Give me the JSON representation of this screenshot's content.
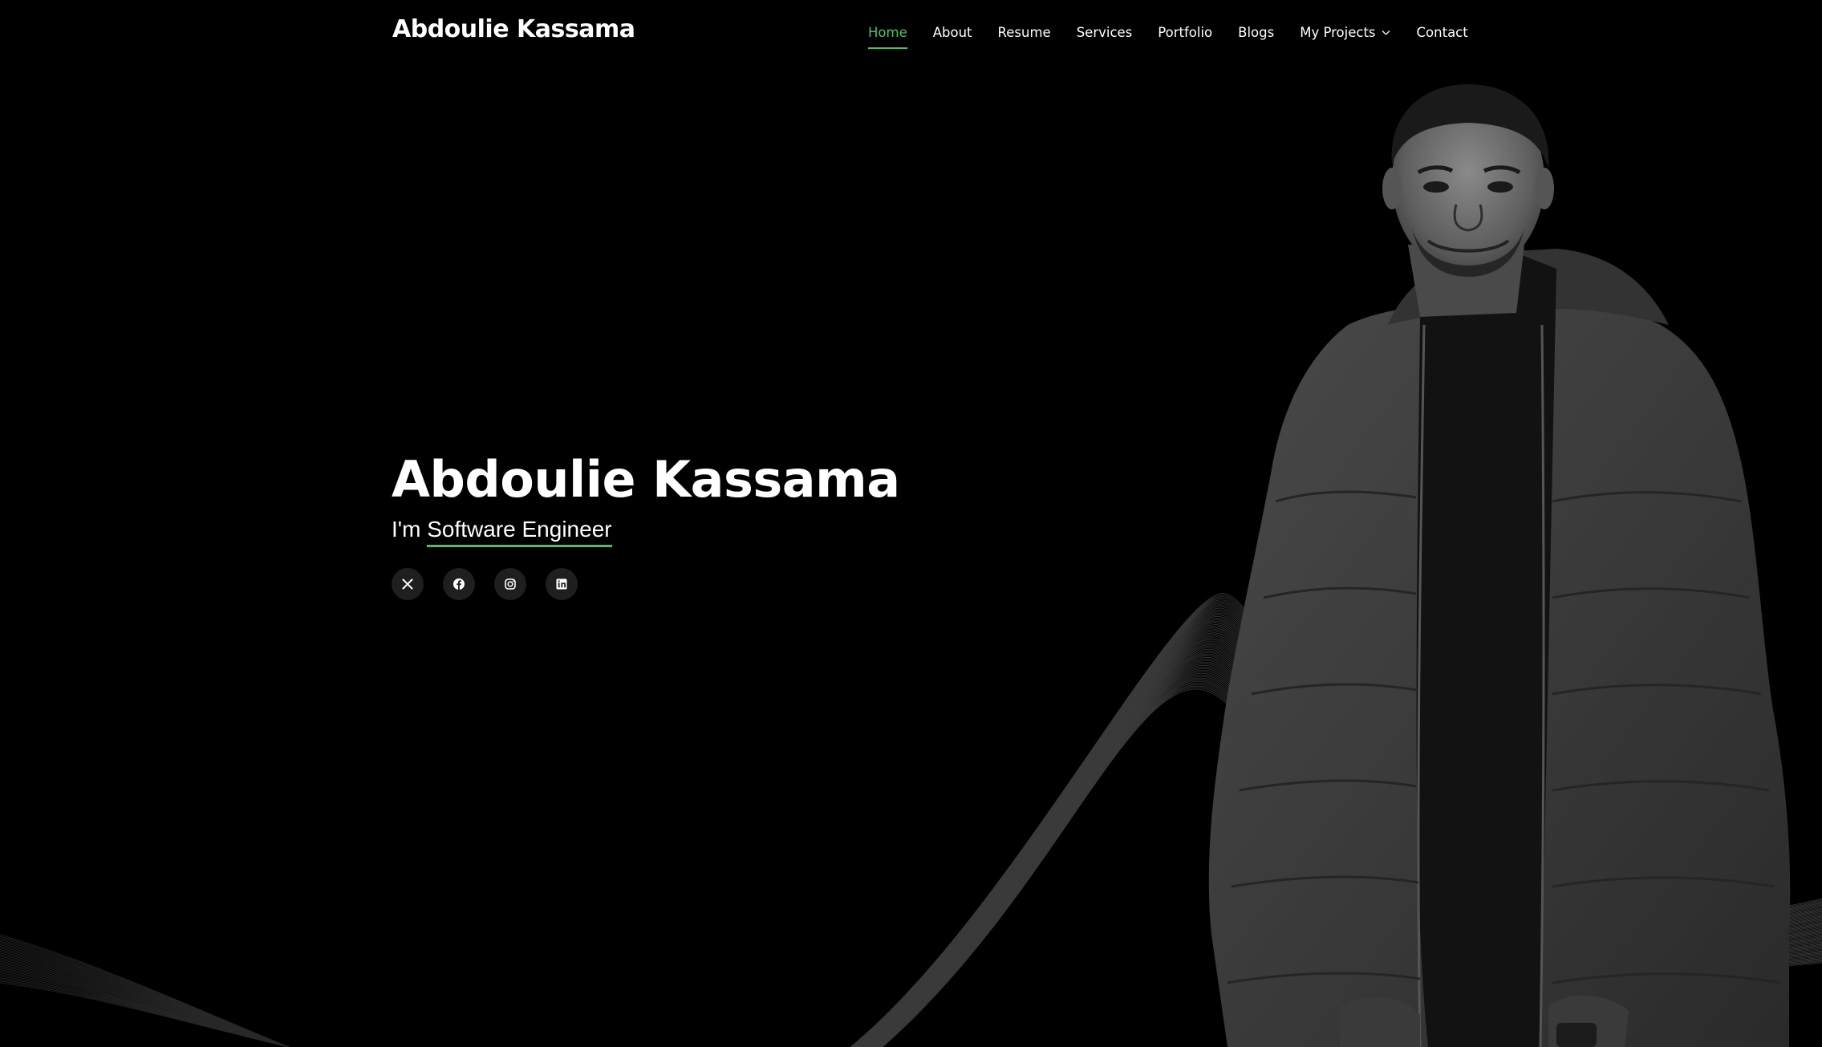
{
  "header": {
    "logo": "Abdoulie Kassama",
    "nav": [
      {
        "label": "Home",
        "active": true
      },
      {
        "label": "About"
      },
      {
        "label": "Resume"
      },
      {
        "label": "Services"
      },
      {
        "label": "Portfolio"
      },
      {
        "label": "Blogs"
      },
      {
        "label": "My Projects",
        "dropdown": true
      },
      {
        "label": "Contact"
      }
    ]
  },
  "hero": {
    "name": "Abdoulie Kassama",
    "prefix": "I'm",
    "role": "Software Engineer",
    "socials": [
      {
        "icon": "x-twitter-icon"
      },
      {
        "icon": "facebook-icon"
      },
      {
        "icon": "instagram-icon"
      },
      {
        "icon": "linkedin-icon"
      }
    ]
  },
  "colors": {
    "background": "#000000",
    "accent": "#4ac25a",
    "text": "#ffffff",
    "social_bg": "#1f1f1f"
  }
}
